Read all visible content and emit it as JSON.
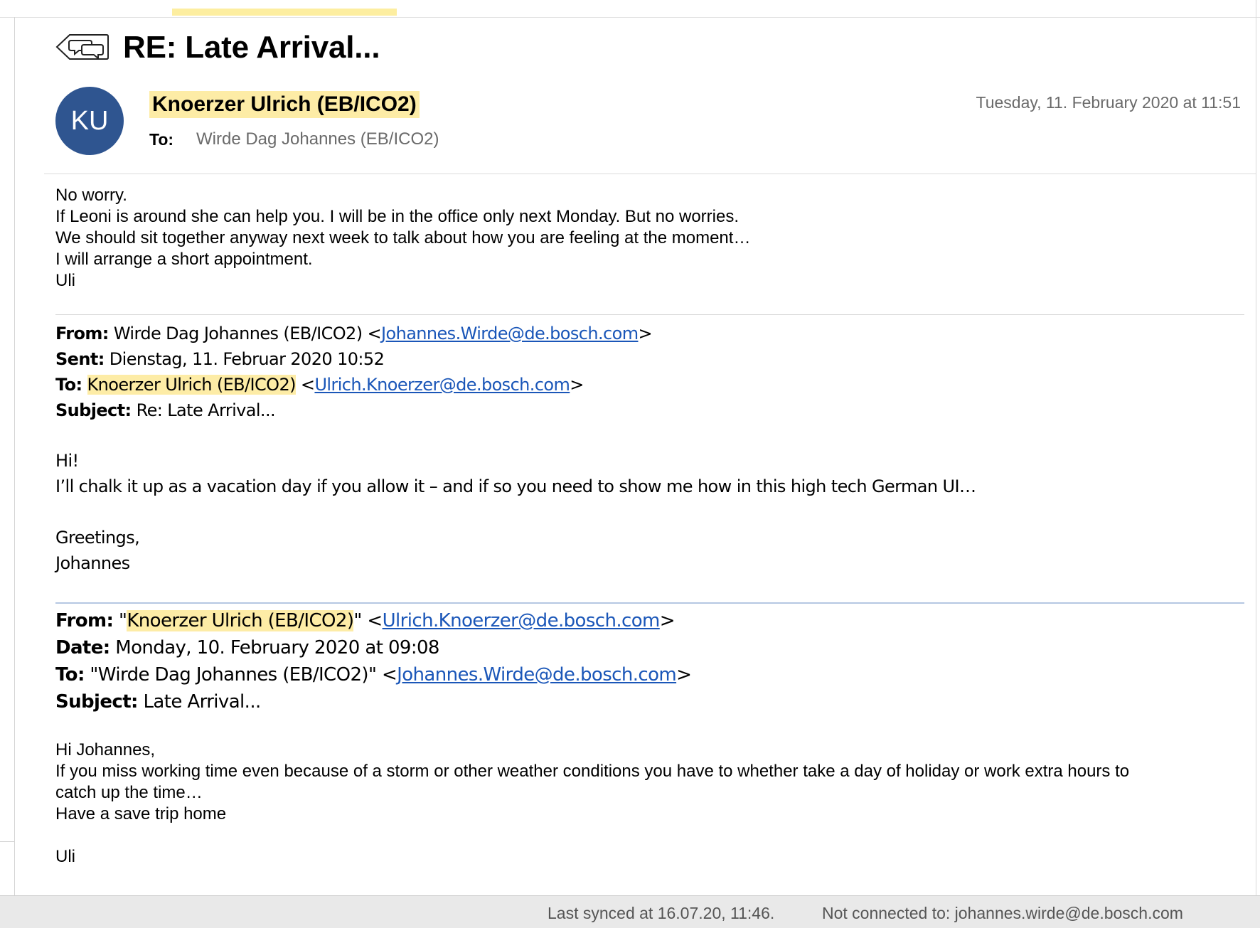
{
  "header": {
    "subject": "RE: Late Arrival...",
    "avatar_initials": "KU",
    "sender": "Knoerzer Ulrich (EB/ICO2)",
    "to_label": "To:",
    "to_value": "Wirde Dag Johannes (EB/ICO2)",
    "timestamp": "Tuesday, 11. February 2020 at 11:51"
  },
  "reply": {
    "lines": [
      "No worry.",
      "If Leoni is around she can help you. I will be in the office only next Monday. But no worries.",
      "We should sit together anyway next week to talk about how you are feeling at the moment…",
      "I will arrange a short appointment.",
      "Uli"
    ]
  },
  "quote1": {
    "from_label": "From:",
    "from_name": "Wirde Dag Johannes (EB/ICO2)",
    "from_email": "Johannes.Wirde@de.bosch.com",
    "sent_label": "Sent:",
    "sent_value": "Dienstag, 11. Februar 2020 10:52",
    "to_label": "To:",
    "to_name": "Knoerzer Ulrich (EB/ICO2)",
    "to_email": "Ulrich.Knoerzer@de.bosch.com",
    "subject_label": "Subject:",
    "subject_value": "Re: Late Arrival...",
    "body": {
      "greeting": "Hi!",
      "line1": "I’ll chalk it up as a vacation day if you allow it – and if so you need to show me how in this high tech German UI…",
      "closing": "Greetings,",
      "signature": "Johannes"
    }
  },
  "quote2": {
    "from_label": "From:",
    "from_name": "Knoerzer Ulrich (EB/ICO2)",
    "from_email": "Ulrich.Knoerzer@de.bosch.com",
    "date_label": "Date:",
    "date_value": "Monday, 10. February 2020 at 09:08",
    "to_label": "To:",
    "to_name": "Wirde Dag Johannes (EB/ICO2)",
    "to_email": "Johannes.Wirde@de.bosch.com",
    "subject_label": "Subject:",
    "subject_value": "Late Arrival...",
    "body": {
      "greeting": "Hi Johannes,",
      "line1": "If you miss working time even because of a storm or other weather conditions you have to whether take a day of holiday or work extra hours to",
      "line2": "catch up the time…",
      "line3": "Have a save trip home",
      "signature": "Uli"
    }
  },
  "status_bar": {
    "sync": "Last synced at 16.07.20, 11:46.",
    "connection": "Not connected to: johannes.wirde@de.bosch.com"
  },
  "colors": {
    "highlight": "#fdeca6",
    "avatar": "#2f5590",
    "link": "#1a56b8"
  }
}
